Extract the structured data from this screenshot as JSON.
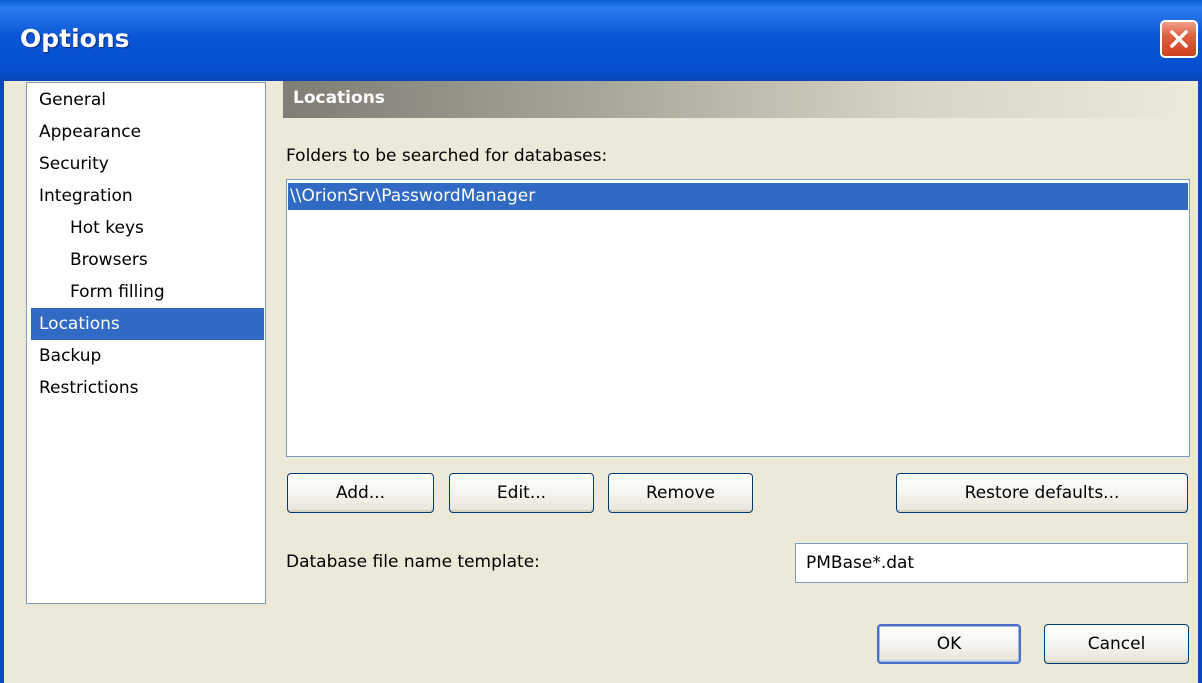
{
  "window": {
    "title": "Options",
    "close_label": "Close"
  },
  "nav": {
    "items": [
      {
        "label": "General",
        "level": 0,
        "selected": false
      },
      {
        "label": "Appearance",
        "level": 0,
        "selected": false
      },
      {
        "label": "Security",
        "level": 0,
        "selected": false
      },
      {
        "label": "Integration",
        "level": 0,
        "selected": false
      },
      {
        "label": "Hot keys",
        "level": 1,
        "selected": false
      },
      {
        "label": "Browsers",
        "level": 1,
        "selected": false
      },
      {
        "label": "Form filling",
        "level": 1,
        "selected": false
      },
      {
        "label": "Locations",
        "level": 0,
        "selected": true
      },
      {
        "label": "Backup",
        "level": 0,
        "selected": false
      },
      {
        "label": "Restrictions",
        "level": 0,
        "selected": false
      }
    ]
  },
  "panel": {
    "header": "Locations",
    "folders_label": "Folders to be searched for databases:",
    "folders": [
      {
        "path": "\\\\OrionSrv\\PasswordManager",
        "selected": true
      }
    ],
    "buttons": {
      "add": "Add...",
      "edit": "Edit...",
      "remove": "Remove",
      "restore": "Restore defaults..."
    },
    "template_label": "Database file name template:",
    "template_value": "PMBase*.dat"
  },
  "footer": {
    "ok": "OK",
    "cancel": "Cancel"
  },
  "colors": {
    "title_bar": "#0a55d6",
    "selection": "#316ac5",
    "window_bg": "#ece9d8"
  }
}
